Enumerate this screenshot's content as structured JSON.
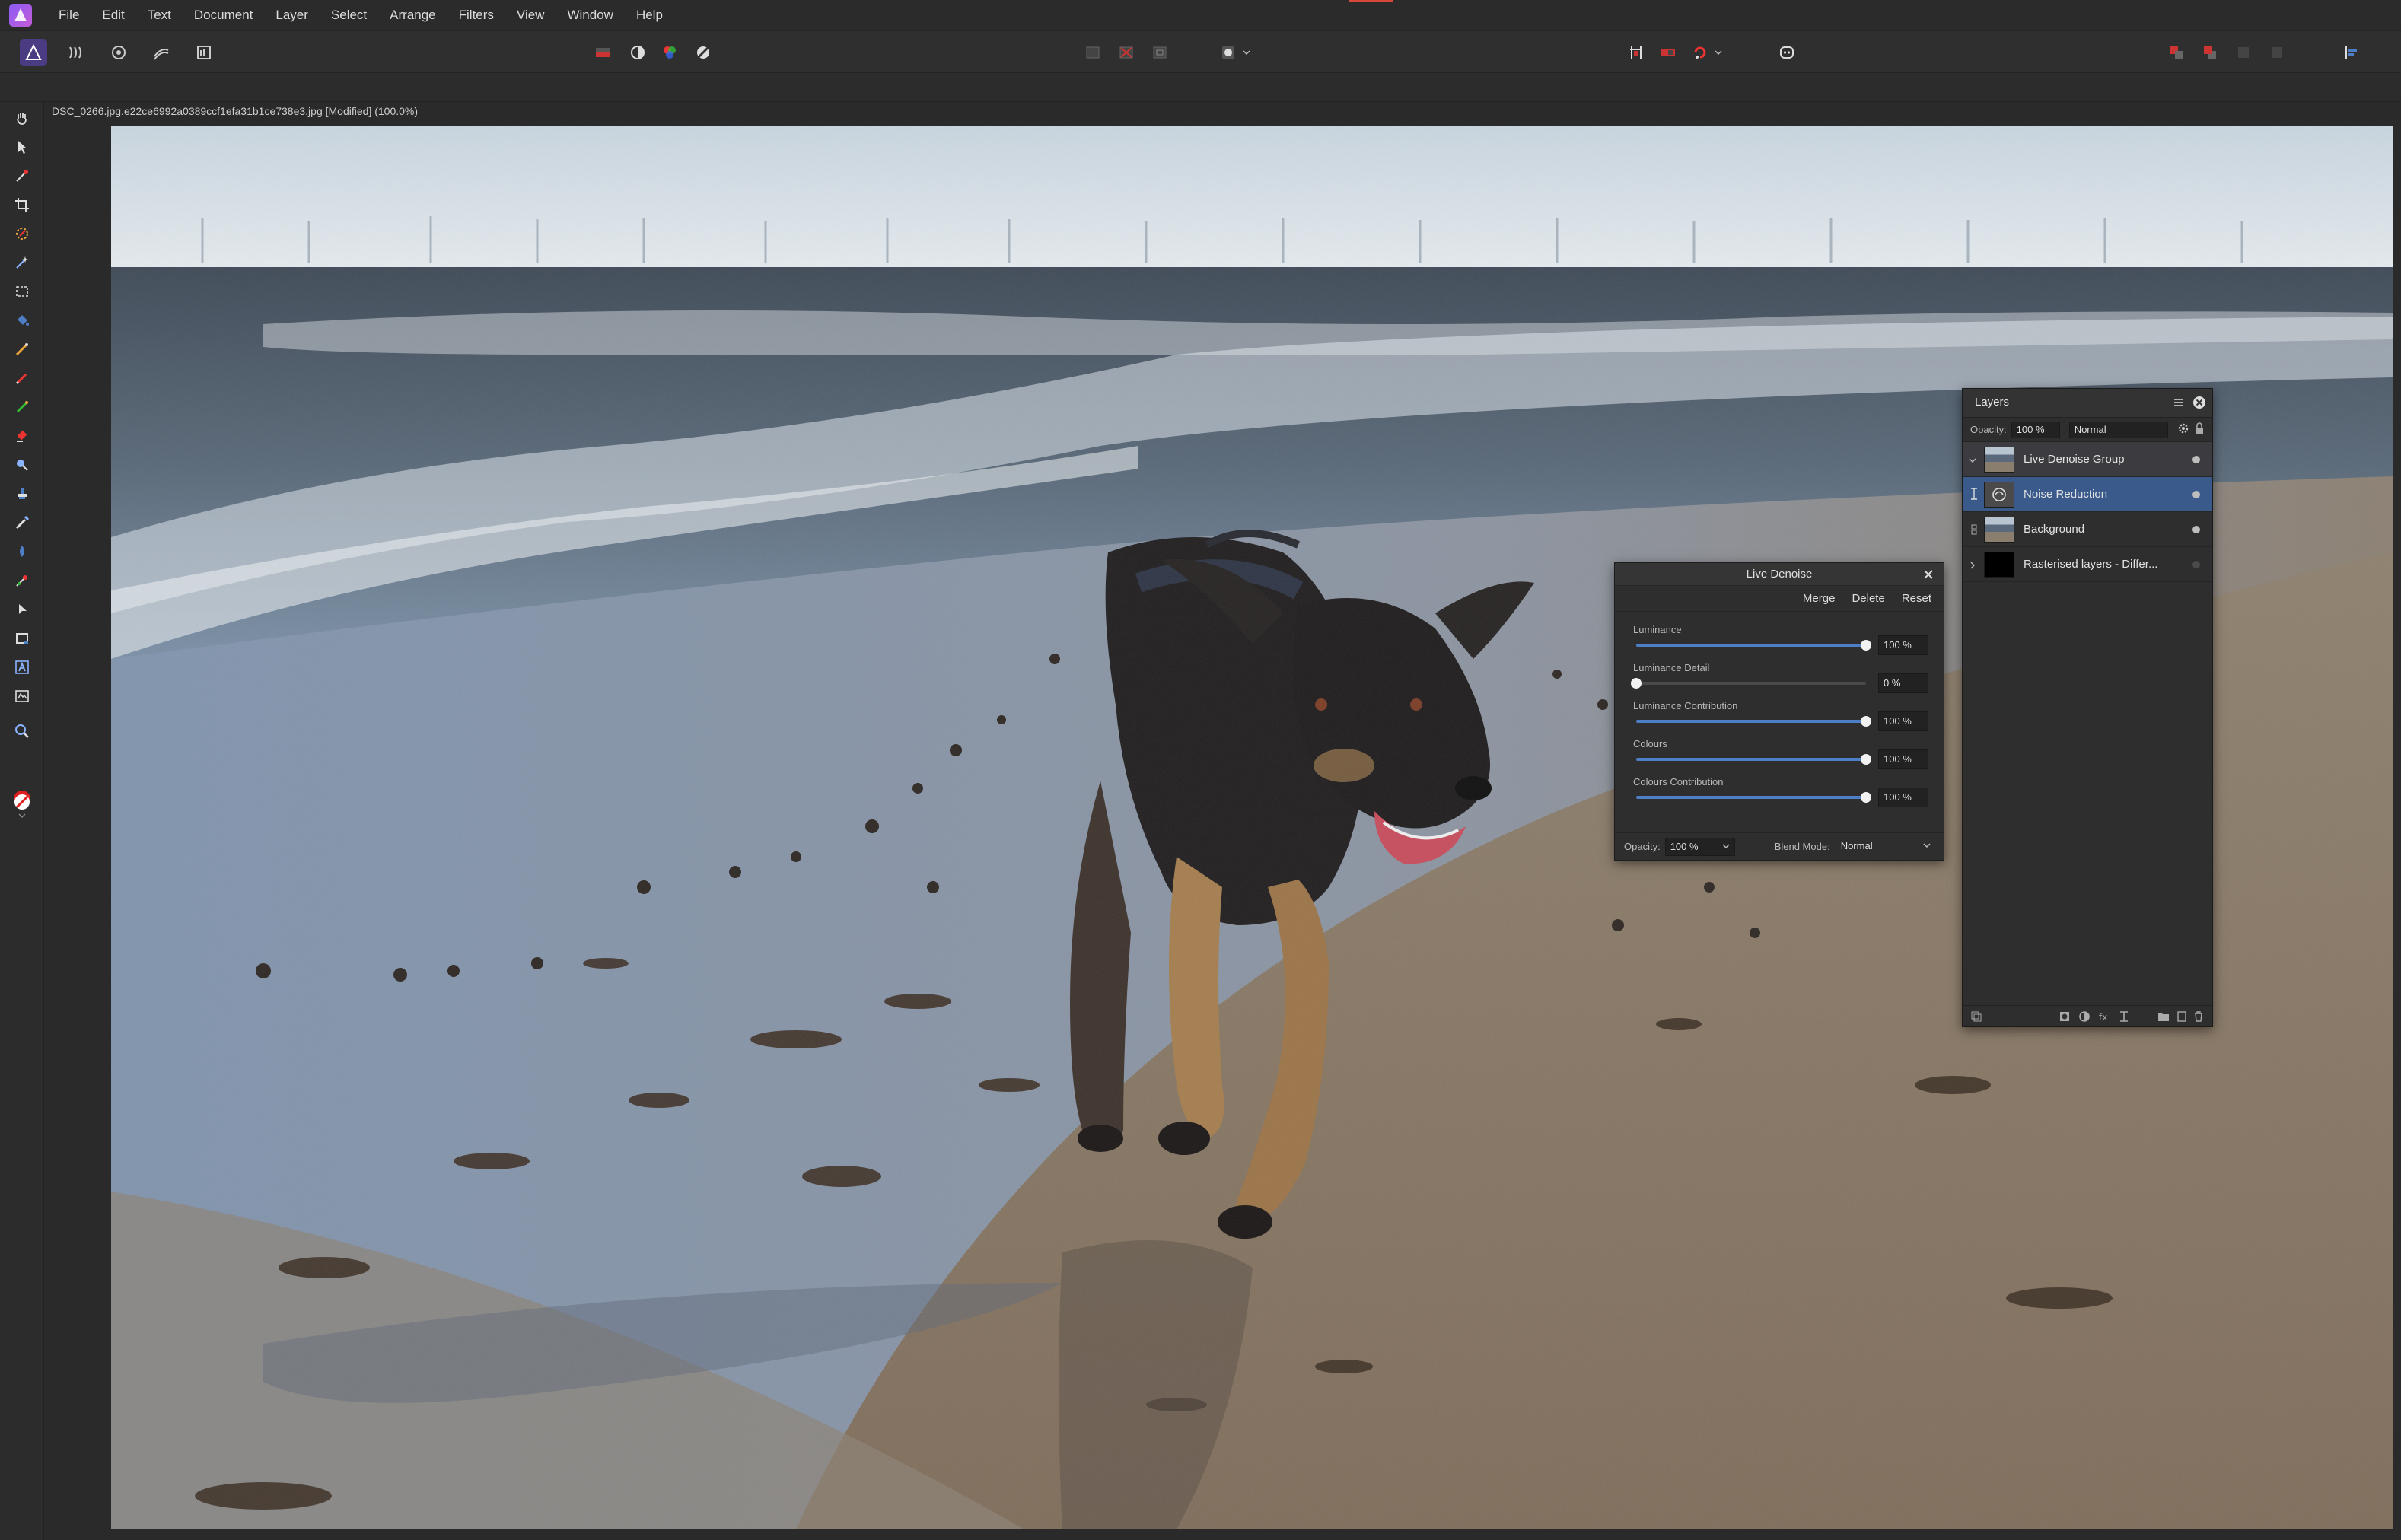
{
  "menubar": {
    "items": [
      "File",
      "Edit",
      "Text",
      "Document",
      "Layer",
      "Select",
      "Arrange",
      "Filters",
      "View",
      "Window",
      "Help"
    ]
  },
  "document": {
    "title": "DSC_0266.jpg.e22ce6992a0389ccf1efa31b1ce738e3.jpg [Modified] (100.0%)"
  },
  "live_denoise": {
    "title": "Live Denoise",
    "actions": {
      "merge": "Merge",
      "delete": "Delete",
      "reset": "Reset"
    },
    "sliders": [
      {
        "label": "Luminance",
        "value": "100 %",
        "fraction": 1.0
      },
      {
        "label": "Luminance Detail",
        "value": "0 %",
        "fraction": 0.0
      },
      {
        "label": "Luminance Contribution",
        "value": "100 %",
        "fraction": 1.0
      },
      {
        "label": "Colours",
        "value": "100 %",
        "fraction": 1.0
      },
      {
        "label": "Colours Contribution",
        "value": "100 %",
        "fraction": 1.0
      }
    ],
    "opacity_label": "Opacity:",
    "opacity_value": "100 %",
    "blend_label": "Blend Mode:",
    "blend_value": "Normal"
  },
  "layers": {
    "tab_label": "Layers",
    "opacity_label": "Opacity:",
    "opacity_value": "100 %",
    "blend_value": "Normal",
    "items": [
      {
        "name": "Live Denoise Group"
      },
      {
        "name": "Noise Reduction"
      },
      {
        "name": "Background"
      },
      {
        "name": "Rasterised layers - Differ..."
      }
    ]
  },
  "colors": {
    "accent": "#4d7fc7",
    "selection": "#3a5a8c",
    "persona": "#4b3b83"
  }
}
